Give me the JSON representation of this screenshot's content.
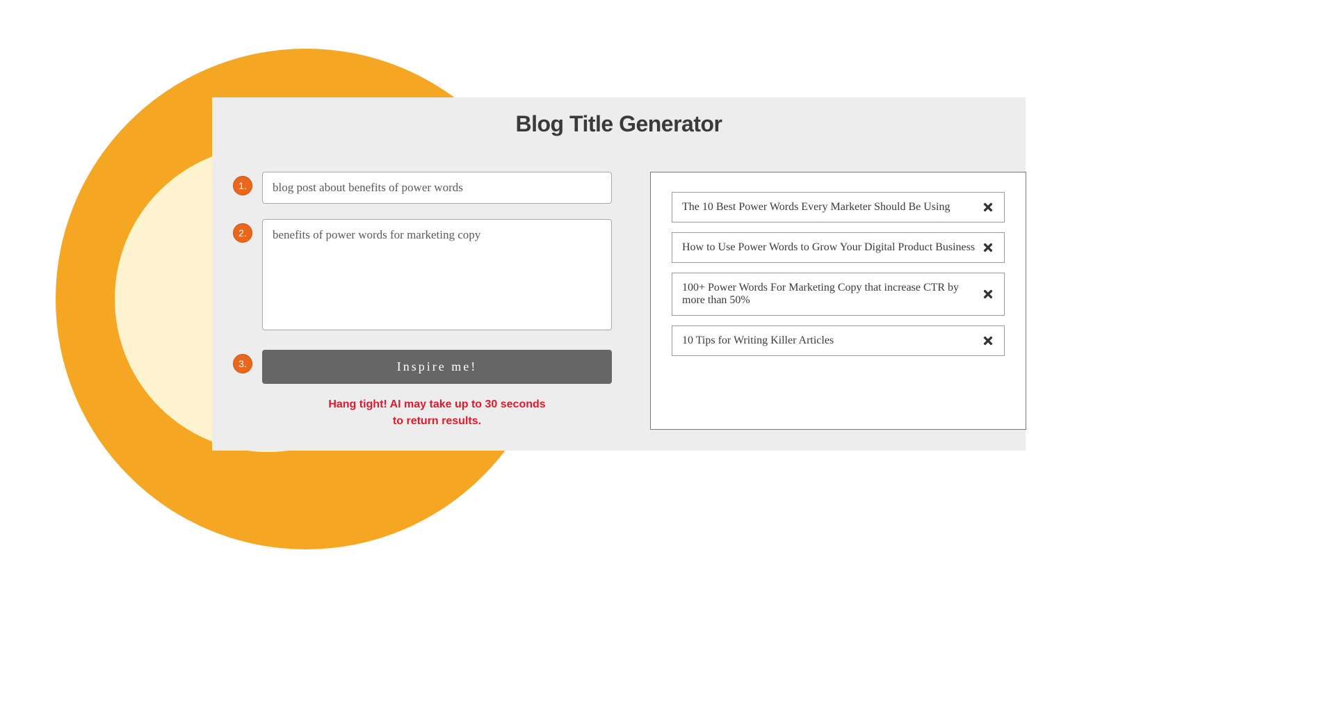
{
  "title": "Blog Title Generator",
  "steps": {
    "s1": {
      "badge": "1.",
      "value": "blog post about benefits of power words"
    },
    "s2": {
      "badge": "2.",
      "value": "benefits of power words for marketing copy"
    },
    "s3": {
      "badge": "3.",
      "button_label": "Inspire me!"
    }
  },
  "status_line1": "Hang tight! AI may take up to 30 seconds",
  "status_line2": "to return results.",
  "results": [
    "The 10 Best Power Words Every Marketer Should Be Using",
    "How to Use Power Words to Grow Your Digital Product Business",
    "100+ Power Words For Marketing Copy that increase CTR by more than 50%",
    "10 Tips for Writing Killer Articles"
  ]
}
